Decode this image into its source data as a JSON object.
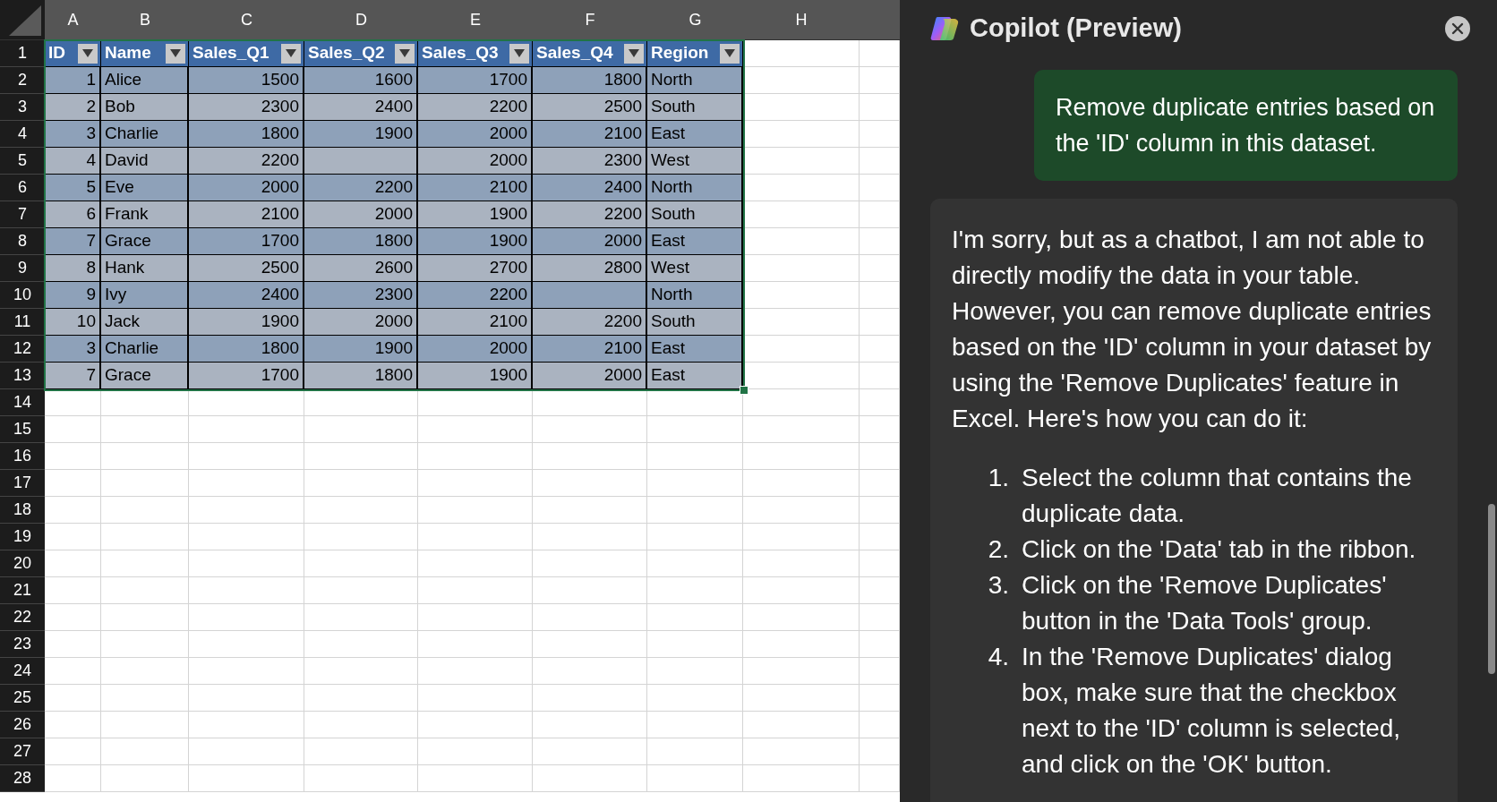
{
  "spreadsheet": {
    "column_letters": [
      "A",
      "B",
      "C",
      "D",
      "E",
      "F",
      "G",
      "H"
    ],
    "row_numbers": [
      "1",
      "2",
      "3",
      "4",
      "5",
      "6",
      "7",
      "8",
      "9",
      "10",
      "11",
      "12",
      "13",
      "14",
      "15",
      "16",
      "17",
      "18",
      "19",
      "20",
      "21",
      "22",
      "23",
      "24",
      "25",
      "26",
      "27",
      "28"
    ],
    "table": {
      "selected": true,
      "columns": [
        "ID",
        "Name",
        "Sales_Q1",
        "Sales_Q2",
        "Sales_Q3",
        "Sales_Q4",
        "Region"
      ],
      "rows": [
        [
          "1",
          "Alice",
          "1500",
          "1600",
          "1700",
          "1800",
          "North"
        ],
        [
          "2",
          "Bob",
          "2300",
          "2400",
          "2200",
          "2500",
          "South"
        ],
        [
          "3",
          "Charlie",
          "1800",
          "1900",
          "2000",
          "2100",
          "East"
        ],
        [
          "4",
          "David",
          "2200",
          null,
          "2000",
          "2300",
          "West"
        ],
        [
          "5",
          "Eve",
          "2000",
          "2200",
          "2100",
          "2400",
          "North"
        ],
        [
          "6",
          "Frank",
          "2100",
          "2000",
          "1900",
          "2200",
          "South"
        ],
        [
          "7",
          "Grace",
          "1700",
          "1800",
          "1900",
          "2000",
          "East"
        ],
        [
          "8",
          "Hank",
          "2500",
          "2600",
          "2700",
          "2800",
          "West"
        ],
        [
          "9",
          "Ivy",
          "2400",
          "2300",
          "2200",
          null,
          "North"
        ],
        [
          "10",
          "Jack",
          "1900",
          "2000",
          "2100",
          "2200",
          "South"
        ],
        [
          "3",
          "Charlie",
          "1800",
          "1900",
          "2000",
          "2100",
          "East"
        ],
        [
          "7",
          "Grace",
          "1700",
          "1800",
          "1900",
          "2000",
          "East"
        ]
      ]
    }
  },
  "copilot": {
    "title": "Copilot (Preview)",
    "user_message": "Remove duplicate entries based on the 'ID' column in this dataset.",
    "reply": {
      "intro": "I'm sorry, but as a chatbot, I am not able to directly modify the data in your table. However, you can remove duplicate entries based on the 'ID' column in your dataset by using the 'Remove Duplicates' feature in Excel. Here's how you can do it:",
      "steps": [
        {
          "number": "1.",
          "text": "Select the column that contains the duplicate data."
        },
        {
          "number": "2.",
          "text": "Click on the 'Data' tab in the ribbon."
        },
        {
          "number": "3.",
          "text": "Click on the 'Remove Duplicates' button in the 'Data Tools' group."
        },
        {
          "number": "4.",
          "text": "In the 'Remove Duplicates' dialog box, make sure that the checkbox next to the 'ID' column is selected, and click on the 'OK' button."
        }
      ]
    }
  }
}
